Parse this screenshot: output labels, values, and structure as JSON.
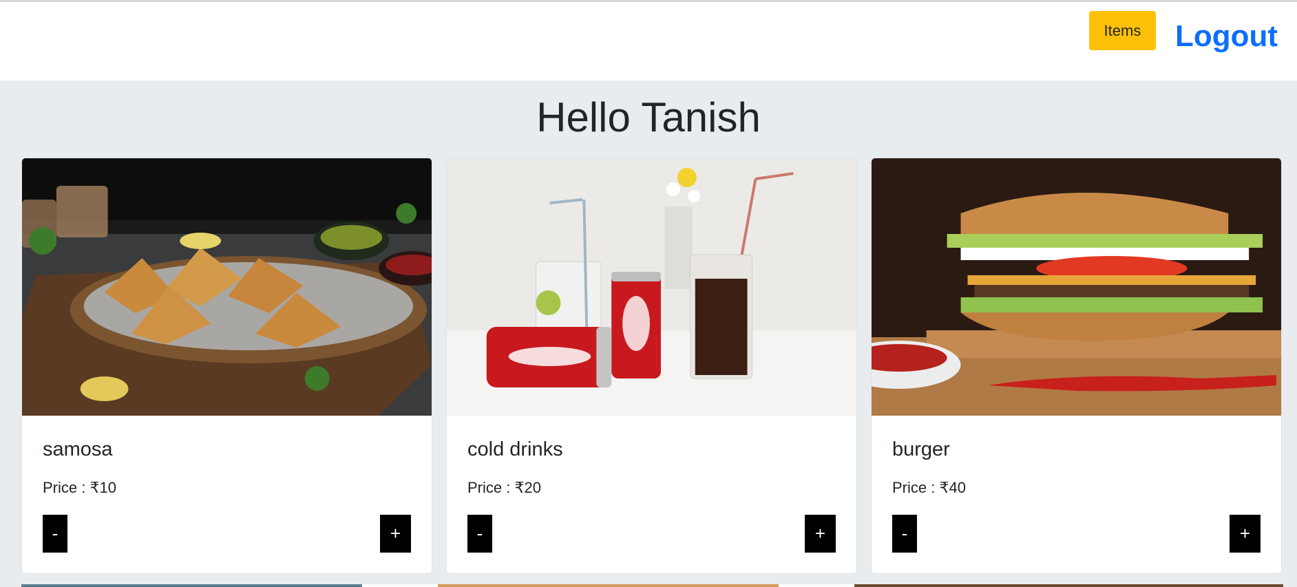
{
  "nav": {
    "items_label": "Items",
    "logout_label": "Logout"
  },
  "greeting": "Hello Tanish",
  "products": [
    {
      "name": "samosa",
      "price_label": "Price :",
      "price": "₹10",
      "minus": "-",
      "plus": "+"
    },
    {
      "name": "cold drinks",
      "price_label": "Price :",
      "price": "₹20",
      "minus": "-",
      "plus": "+"
    },
    {
      "name": "burger",
      "price_label": "Price :",
      "price": "₹40",
      "minus": "-",
      "plus": "+"
    }
  ],
  "colors": {
    "items_button": "#ffc107",
    "logout_link": "#0d6efd",
    "page_bg": "#e9ecef",
    "stepper_button": "#000000"
  }
}
